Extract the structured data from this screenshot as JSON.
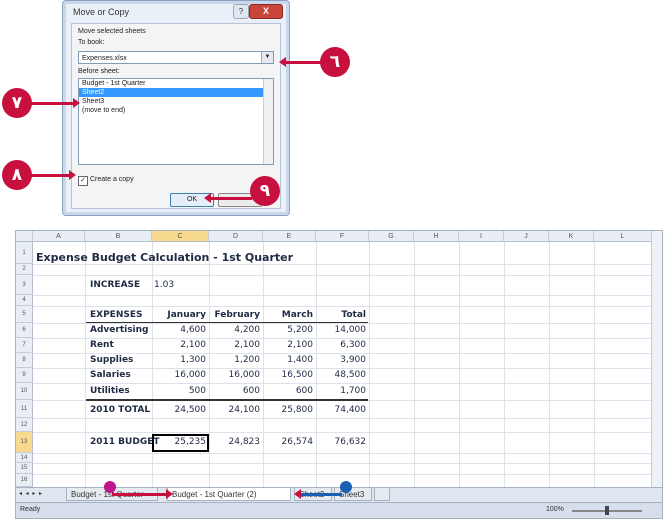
{
  "dialog": {
    "title": "Move or Copy",
    "help": "?",
    "close": "X",
    "move_label": "Move selected sheets",
    "tobook_label": "To book:",
    "tobook_value": "Expenses.xlsx",
    "before_label": "Before sheet:",
    "before_items": [
      "Budget - 1st Quarter",
      "Sheet2",
      "Sheet3",
      "(move to end)"
    ],
    "create_copy_label": "Create a copy",
    "ok_label": "OK"
  },
  "callouts": {
    "step6": "٦",
    "step7": "٧",
    "step8": "٨",
    "step9": "٩"
  },
  "sheet": {
    "columns": [
      "A",
      "B",
      "C",
      "D",
      "E",
      "F",
      "G",
      "H",
      "I",
      "J",
      "K",
      "L"
    ],
    "rows": [
      "1",
      "2",
      "3",
      "4",
      "5",
      "6",
      "7",
      "8",
      "9",
      "10",
      "11",
      "12",
      "13",
      "14",
      "15",
      "16"
    ],
    "title": "Expense Budget Calculation - 1st Quarter",
    "increase_label": "INCREASE",
    "increase_value": "1.03",
    "headers": [
      "EXPENSES",
      "January",
      "February",
      "March",
      "Total"
    ],
    "data_rows": [
      [
        "Advertising",
        "4,600",
        "4,200",
        "5,200",
        "14,000"
      ],
      [
        "Rent",
        "2,100",
        "2,100",
        "2,100",
        "6,300"
      ],
      [
        "Supplies",
        "1,300",
        "1,200",
        "1,400",
        "3,900"
      ],
      [
        "Salaries",
        "16,000",
        "16,000",
        "16,500",
        "48,500"
      ],
      [
        "Utilities",
        "500",
        "600",
        "600",
        "1,700"
      ]
    ],
    "total_row": [
      "2010 TOTAL",
      "24,500",
      "24,100",
      "25,800",
      "74,400"
    ],
    "budget_row": [
      "2011 BUDGET",
      "25,235",
      "24,823",
      "26,574",
      "76,632"
    ],
    "tab_nav": "◂ ◂ ▸ ▸",
    "tabs": [
      "Budget - 1st Quarter",
      "Budget - 1st Quarter (2)",
      "Sheet2",
      "Sheet3"
    ],
    "status_ready": "Ready",
    "zoom": "100%"
  },
  "colors": {
    "callout": "#c8103e",
    "dot_magenta": "#c0168a",
    "dot_blue": "#1a5fb4",
    "selection": "#3399ff"
  }
}
